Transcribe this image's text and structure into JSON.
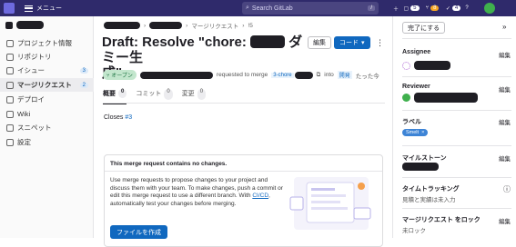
{
  "topbar": {
    "menu_label": "メニュー",
    "search_placeholder": "Search GitLab",
    "search_shortcut": "/",
    "issues_count": "5",
    "mr_count": "8",
    "todo_count": "4"
  },
  "sidebar": {
    "items": [
      {
        "label": "プロジェクト情報",
        "icon": "info-icon"
      },
      {
        "label": "リポジトリ",
        "icon": "repository-icon"
      },
      {
        "label": "イシュー",
        "icon": "issues-icon",
        "count": "3"
      },
      {
        "label": "マージリクエスト",
        "icon": "merge-request-icon",
        "count": "2"
      },
      {
        "label": "デプロイ",
        "icon": "rocket-icon"
      },
      {
        "label": "Wiki",
        "icon": "book-icon"
      },
      {
        "label": "スニペット",
        "icon": "snippet-icon"
      },
      {
        "label": "設定",
        "icon": "gear-icon"
      }
    ]
  },
  "breadcrumb": {
    "separator": "›",
    "section": "マージリクエスト",
    "number": "!5"
  },
  "mr": {
    "title_start": "Draft: Resolve \"chore:",
    "title_mid": "ダミー生",
    "title_end": "成\"",
    "edit_label": "編集",
    "code_label": "コード",
    "kebab": "⋮",
    "status": "オープン",
    "requested_to_merge": "requested to merge",
    "source_branch": "3-chore",
    "into": "into",
    "target_branch": "開発",
    "time": "たった今"
  },
  "tabs": [
    {
      "label": "概要",
      "count": "0"
    },
    {
      "label": "コミット",
      "count": "0"
    },
    {
      "label": "変更",
      "count": "0"
    }
  ],
  "closes": {
    "label": "Closes",
    "issue": "#3"
  },
  "empty_card": {
    "heading": "This merge request contains no changes.",
    "body_1": "Use merge requests to propose changes to your project and discuss them with your team. To make changes, push a commit or edit this merge request to use a different branch. With",
    "link": "CI/CD",
    "body_2": ", automatically test your changes before merging.",
    "button": "ファイルを作成"
  },
  "right_sidebar": {
    "done_label": "完了にする",
    "collapse": "»",
    "edit": "編集",
    "assignee_title": "Assignee",
    "reviewer_title": "Reviewer",
    "labels_title": "ラベル",
    "label_chip": "Smelt",
    "milestone_title": "マイルストーン",
    "time_title": "タイムトラッキング",
    "time_value": "見積と実績は未入力",
    "lock_title": "マージリクエスト をロック",
    "lock_value": "未ロック"
  }
}
